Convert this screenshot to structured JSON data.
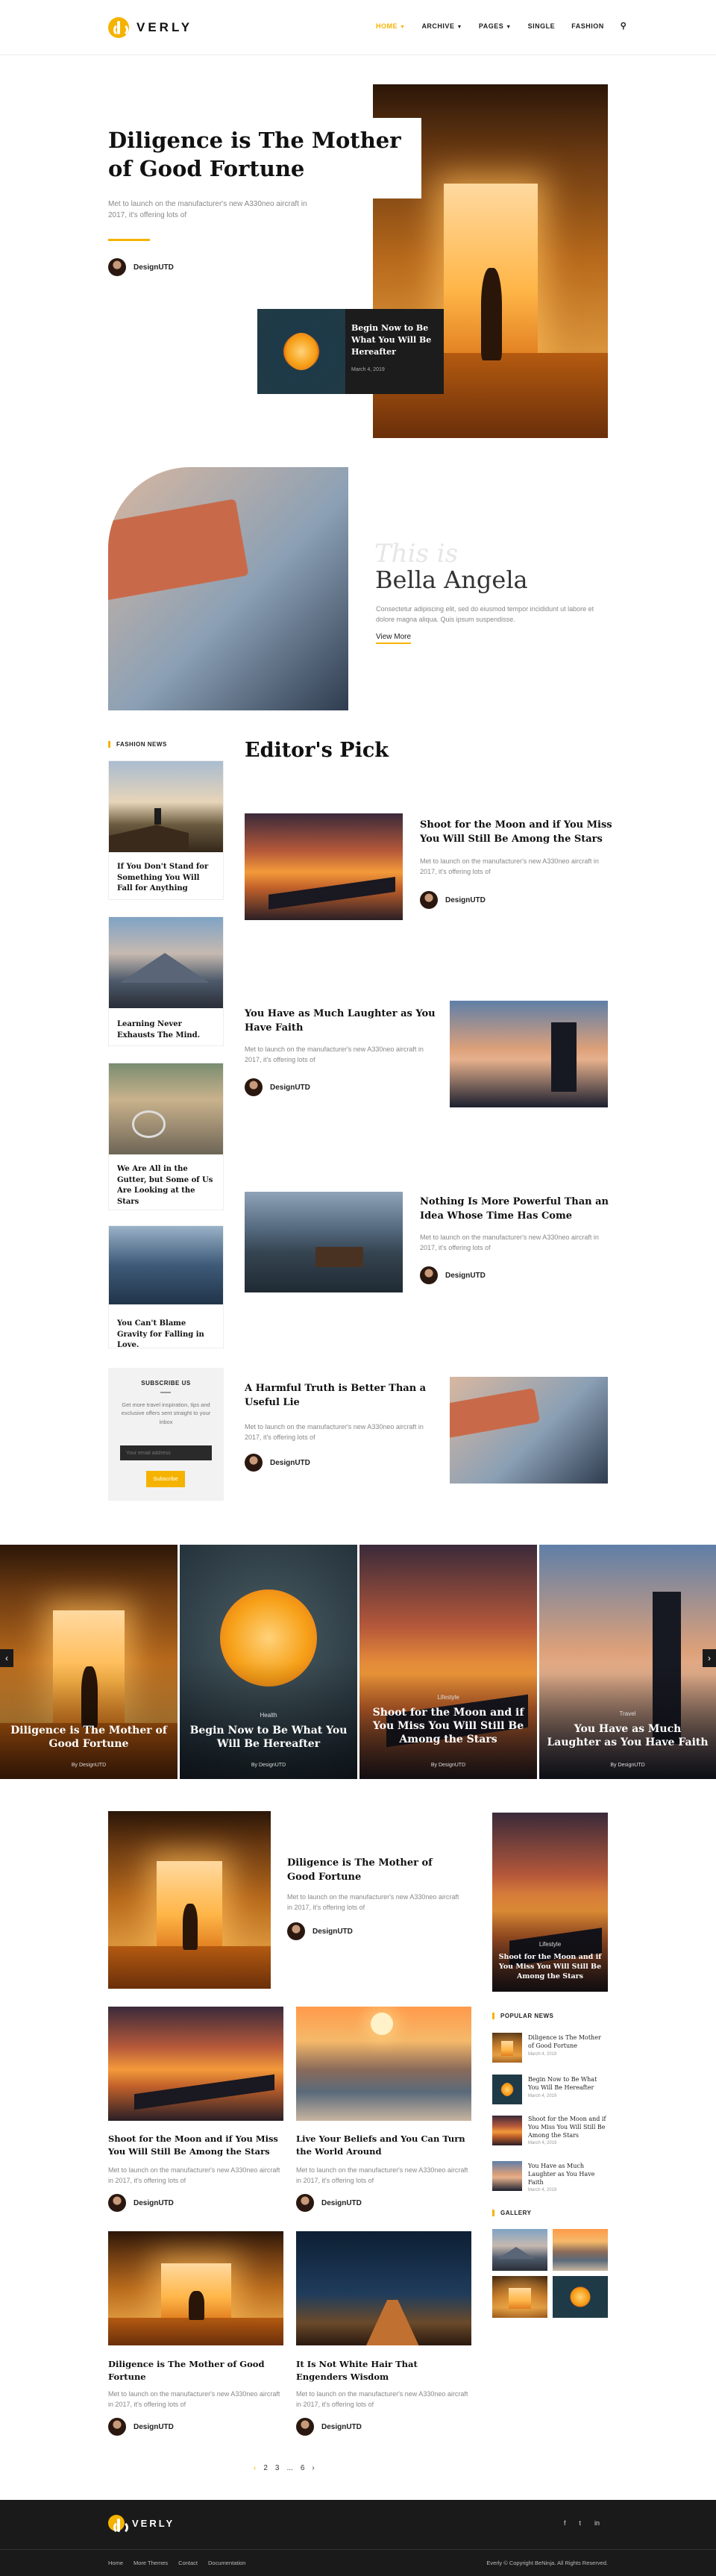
{
  "header": {
    "logo_text": "VERLY",
    "nav": [
      {
        "label": "HOME",
        "active": true,
        "has_dropdown": true
      },
      {
        "label": "ARCHIVE",
        "has_dropdown": true
      },
      {
        "label": "PAGES",
        "has_dropdown": true
      },
      {
        "label": "SINGLE",
        "has_dropdown": false
      },
      {
        "label": "FASHION",
        "has_dropdown": false
      }
    ],
    "search_icon": "search-icon"
  },
  "hero": {
    "title": "Diligence is The Mother of Good Fortune",
    "excerpt": "Met to launch on the manufacturer's new A330neo aircraft in 2017, it's offering lots of",
    "author": "DesignUTD",
    "side_card": {
      "title": "Begin Now to Be What You Will Be Hereafter",
      "date": "March 4, 2019"
    }
  },
  "about": {
    "script": "This is",
    "name": "Bella Angela",
    "text": "Consectetur adipiscing elit, sed do eiusmod tempor incididunt ut labore et dolore magna aliqua. Quis ipsum suspendisse.",
    "link": "View More"
  },
  "sidebar_left": {
    "label": "FASHION NEWS",
    "items": [
      {
        "title": "If You Don't Stand for Something You Will Fall for Anything"
      },
      {
        "title": "Learning Never Exhausts The Mind."
      },
      {
        "title": "We Are All in the Gutter, but Some of Us Are Looking at the Stars"
      },
      {
        "title": "You Can't Blame Gravity for Falling in Love."
      }
    ],
    "subscribe": {
      "title": "SUBSCRIBE US",
      "text": "Get more travel inspiration, tips and exclusive offers sent straight to your inbox",
      "placeholder": "Your email address",
      "button": "Subscribe"
    }
  },
  "editors_pick": {
    "title": "Editor's Pick",
    "posts": [
      {
        "title": "Shoot for the Moon and if You Miss You Will Still Be Among the Stars",
        "excerpt": "Met to launch on the manufacturer's new A330neo aircraft in 2017, it's offering lots of",
        "author": "DesignUTD"
      },
      {
        "title": "You Have as Much Laughter as You Have Faith",
        "excerpt": "Met to launch on the manufacturer's new A330neo aircraft in 2017, it's offering lots of",
        "author": "DesignUTD"
      },
      {
        "title": "Nothing Is More Powerful Than an Idea Whose Time Has Come",
        "excerpt": "Met to launch on the manufacturer's new A330neo aircraft in 2017, it's offering lots of",
        "author": "DesignUTD"
      },
      {
        "title": "A Harmful Truth is Better Than a Useful Lie",
        "excerpt": "Met to launch on the manufacturer's new A330neo aircraft in 2017, it's offering lots of",
        "author": "DesignUTD"
      }
    ]
  },
  "slider": {
    "slides": [
      {
        "category": "",
        "title": "Diligence is The Mother of Good Fortune",
        "by": "By DesignUTD"
      },
      {
        "category": "Health",
        "title": "Begin Now to Be What You Will Be Hereafter",
        "by": "By DesignUTD"
      },
      {
        "category": "Lifestyle",
        "title": "Shoot for the Moon and if You Miss You Will Still Be Among the Stars",
        "by": "By DesignUTD"
      },
      {
        "category": "Travel",
        "title": "You Have as Much Laughter as You Have Faith",
        "by": "By DesignUTD"
      }
    ],
    "prev": "‹",
    "next": "›"
  },
  "feed": {
    "featured": {
      "title": "Diligence is The Mother of Good Fortune",
      "excerpt": "Met to launch on the manufacturer's new A330neo aircraft in 2017, it's offering lots of",
      "author": "DesignUTD"
    },
    "grid": [
      {
        "title": "Shoot for the Moon and if You Miss You Will Still Be Among the Stars",
        "excerpt": "Met to launch on the manufacturer's new A330neo aircraft in 2017, it's offering lots of",
        "author": "DesignUTD"
      },
      {
        "title": "Live Your Beliefs and You Can Turn the World Around",
        "excerpt": "Met to launch on the manufacturer's new A330neo aircraft in 2017, it's offering lots of",
        "author": "DesignUTD"
      },
      {
        "title": "Diligence is The Mother of Good Fortune",
        "excerpt": "Met to launch on the manufacturer's new A330neo aircraft in 2017, it's offering lots of",
        "author": "DesignUTD"
      },
      {
        "title": "It Is Not White Hair That Engenders Wisdom",
        "excerpt": "Met to launch on the manufacturer's new A330neo aircraft in 2017, it's offering lots of",
        "author": "DesignUTD"
      }
    ],
    "pagination": [
      "‹",
      "2",
      "3",
      "...",
      "6",
      "›"
    ]
  },
  "sidebar_right": {
    "feature": {
      "category": "Lifestyle",
      "title": "Shoot for the Moon and if You Miss You Will Still Be Among the Stars"
    },
    "popular_label": "POPULAR NEWS",
    "popular": [
      {
        "title": "Diligence is The Mother of Good Fortune",
        "date": "March 4, 2019"
      },
      {
        "title": "Begin Now to Be What You Will Be Hereafter",
        "date": "March 4, 2019"
      },
      {
        "title": "Shoot for the Moon and if You Miss You Will Still Be Among the Stars",
        "date": "March 4, 2019"
      },
      {
        "title": "You Have as Much Laughter as You Have Faith",
        "date": "March 4, 2019"
      }
    ],
    "gallery_label": "GALLERY"
  },
  "footer": {
    "logo_text": "VERLY",
    "social": [
      "f",
      "t",
      "in"
    ],
    "links": [
      "Home",
      "More Themes",
      "Contact",
      "Documentation"
    ],
    "copyright": "Everly © Copyright BeNinja. All Rights Reserved."
  },
  "colors": {
    "accent": "#f5b300",
    "dark": "#1a1a1a"
  }
}
